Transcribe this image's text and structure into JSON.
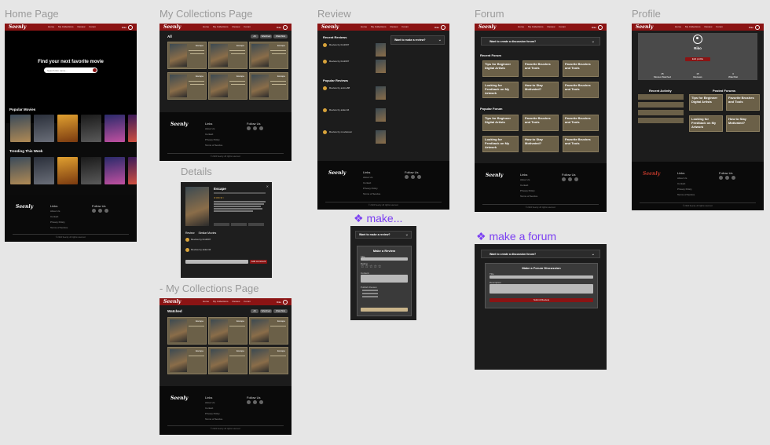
{
  "frames": {
    "home": {
      "label": "Home Page"
    },
    "collections": {
      "label": "My Collections Page"
    },
    "review": {
      "label": "Review"
    },
    "forum": {
      "label": "Forum"
    },
    "profile": {
      "label": "Profile"
    },
    "details": {
      "label": "Details"
    },
    "collections2": {
      "label": "- My Collections Page"
    },
    "make_review": {
      "label": "make..."
    },
    "make_forum": {
      "label": "make a forum"
    }
  },
  "nav": {
    "logo": "Seenly",
    "links": [
      "Home",
      "My Collections",
      "Review",
      "Forum"
    ],
    "user": "Riko"
  },
  "home": {
    "hero_title": "Find your next favorite movie",
    "search_placeholder": "Search film name...",
    "popular_title": "Popular Movies",
    "trending_title": "Trending This Week"
  },
  "footer": {
    "logo": "Seenly",
    "links_title": "Links",
    "links": [
      "About Us",
      "Contact",
      "Privacy Policy",
      "Terms of Service"
    ],
    "follow_title": "Follow Us",
    "copyright": "© 2024 Seenly. All rights reserved."
  },
  "collections": {
    "tab_all": "All",
    "filters": [
      "All",
      "Watched",
      "Watchlist"
    ],
    "tab_watched": "Watched",
    "card_title": "Escape"
  },
  "review": {
    "recent_title": "Recent Reviews",
    "popular_title": "Popular Reviews",
    "dropdown": "Want to make a review?",
    "recent_items": [
      "Review by bin2007",
      "Review by bin2007"
    ],
    "popular_items": [
      "Review by anime88",
      "Review by aiden44",
      "Review by movielover"
    ]
  },
  "forum": {
    "dropdown": "Want to create a discussion forum?",
    "recent_title": "Recent Forum",
    "popular_title": "Popular Forum",
    "topics": [
      "Tips for Beginner Digital Artists",
      "Favorite Brushes and Tools",
      "Favorite Brushes and Tools",
      "Looking for Feedback on My Artwork",
      "How to Stay Motivated?",
      "Favorite Brushes and Tools"
    ]
  },
  "profile": {
    "name": "Riko",
    "edit_button": "Edit profile",
    "stats": [
      {
        "value": "45",
        "label": "Movies Watched"
      },
      {
        "value": "15",
        "label": "Reviews"
      },
      {
        "value": "3",
        "label": "Watchlist"
      }
    ],
    "recent_activity": "Recent Activity",
    "posted_forums": "Posted Forums",
    "forums": [
      "Tips for Beginner Digital Artists",
      "Favorite Brushes and Tools",
      "Looking for Feedback on My Artwork",
      "How to Stay Motivated?"
    ]
  },
  "details": {
    "title": "Escape",
    "tabs": [
      "Review",
      "Similar Movies"
    ],
    "add_comment": "Add comment",
    "reviews": [
      "Review by bin2007",
      "Review by aiden44"
    ]
  },
  "make_review": {
    "dropdown": "Want to make a review?",
    "panel_title": "Make a Review",
    "title_label": "Title",
    "rating_label": "Rating",
    "stars": "☆☆☆☆☆",
    "content_label": "Content",
    "publish_label": "Publish Review"
  },
  "make_forum": {
    "dropdown": "Want to create a discussion forum?",
    "panel_title": "Make a Forum Discussion",
    "title_label": "Title",
    "description_label": "Description",
    "submit": "Submit Review"
  }
}
